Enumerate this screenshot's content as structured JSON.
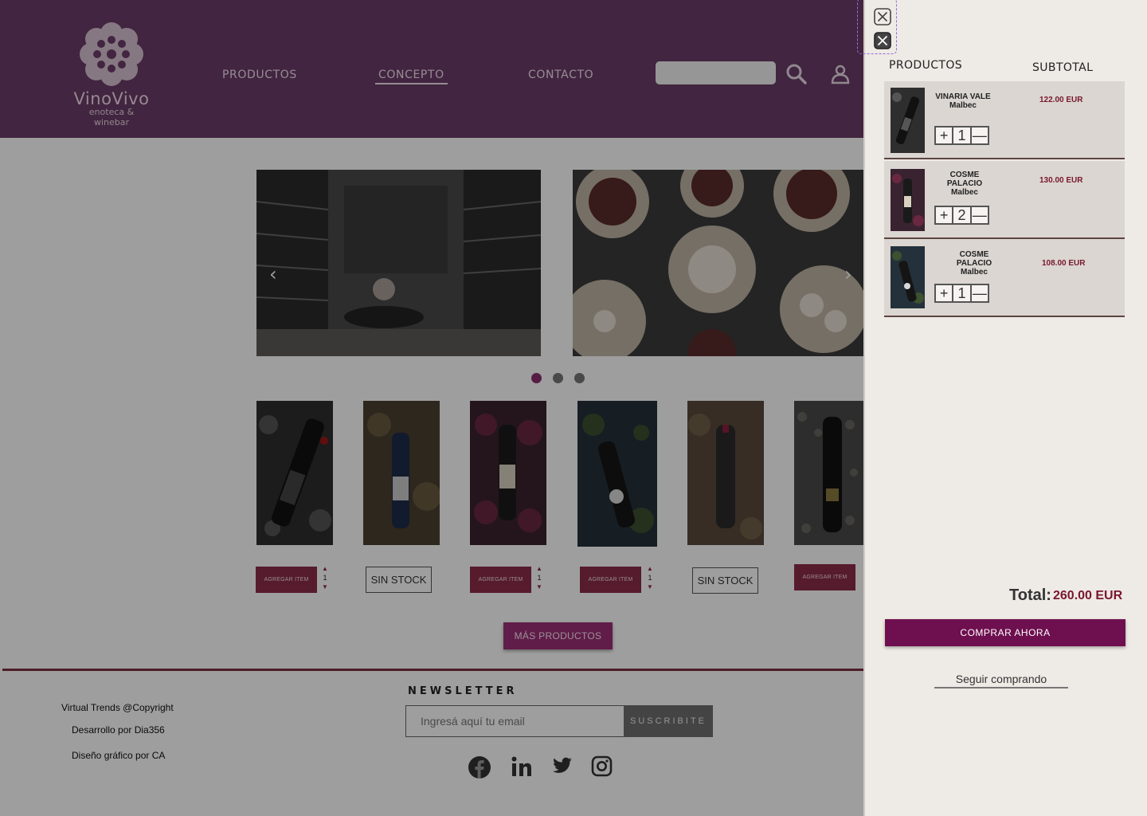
{
  "brand": {
    "name": "VinoVivo",
    "tagline": "enoteca & winebar"
  },
  "nav": {
    "items": [
      "PRODUCTOS",
      "CONCEPTO",
      "CONTACTO"
    ],
    "active": "CONCEPTO"
  },
  "carousel": {
    "prev": "‹",
    "next": "›",
    "slides": 3,
    "active_slide": 1
  },
  "products": [
    {
      "action": "AGREGAR ITEM",
      "qty": "1",
      "in_stock": true
    },
    {
      "action": "SIN STOCK",
      "in_stock": false
    },
    {
      "action": "AGREGAR ITEM",
      "qty": "1",
      "in_stock": true
    },
    {
      "action": "AGREGAR ITEM",
      "qty": "1",
      "in_stock": true
    },
    {
      "action": "SIN STOCK",
      "in_stock": false
    },
    {
      "action": "AGREGAR ITEM",
      "in_stock": true
    }
  ],
  "more_button": "MÁS PRODUCTOS",
  "footer": {
    "copyright": "Virtual Trends @Copyright",
    "dev": "Desarrollo por Dia356",
    "design": "Diseño gráfico por CA",
    "newsletter_title": "NEWSLETTER",
    "email_placeholder": "Ingresá aquí tu email",
    "subscribe": "SUSCRIBITE",
    "social": [
      "facebook-icon",
      "linkedin-icon",
      "twitter-icon",
      "instagram-icon"
    ]
  },
  "cart": {
    "col_products": "PRODUCTOS",
    "col_subtotal": "SUBTOTAL",
    "items": [
      {
        "name": "VINARIA VALE",
        "variety": "Malbec",
        "price": "122.00 EUR",
        "qty": "1"
      },
      {
        "name": "COSME PALACIO",
        "variety": "Malbec",
        "price": "130.00 EUR",
        "qty": "2"
      },
      {
        "name": "COSME PALACIO",
        "variety": "Malbec",
        "price": "108.00 EUR",
        "qty": "1"
      }
    ],
    "stepper_plus": "+",
    "stepper_minus": "—",
    "total_label": "Total:",
    "total_value": "260.00 EUR",
    "buy": "COMPRAR  AHORA",
    "continue": "Seguir comprando"
  },
  "colors": {
    "header": "#6b3d68",
    "accent": "#6e0f4f",
    "wine": "#7a1730",
    "drawer": "#eeeae5"
  }
}
